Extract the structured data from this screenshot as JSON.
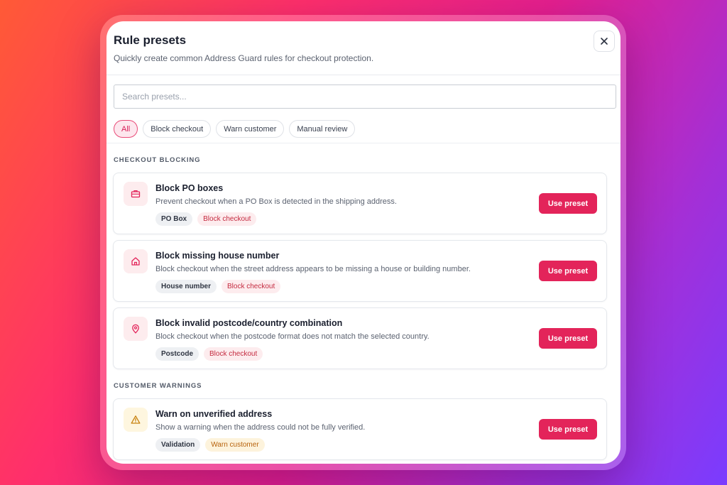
{
  "modal": {
    "title": "Rule presets",
    "subtitle": "Quickly create common Address Guard rules for checkout protection.",
    "close_icon": "close-icon"
  },
  "search": {
    "placeholder": "Search presets..."
  },
  "filters": [
    {
      "label": "All",
      "active": true
    },
    {
      "label": "Block checkout",
      "active": false
    },
    {
      "label": "Warn customer",
      "active": false
    },
    {
      "label": "Manual review",
      "active": false
    }
  ],
  "sections": {
    "blocking": {
      "label": "CHECKOUT BLOCKING",
      "presets": [
        {
          "icon": "briefcase-icon",
          "title": "Block PO boxes",
          "description": "Prevent checkout when a PO Box is detected in the shipping address.",
          "tags": [
            "PO Box",
            "Block checkout"
          ],
          "button": "Use preset"
        },
        {
          "icon": "home-icon",
          "title": "Block missing house number",
          "description": "Block checkout when the street address appears to be missing a house or building number.",
          "tags": [
            "House number",
            "Block checkout"
          ],
          "button": "Use preset"
        },
        {
          "icon": "map-pin-icon",
          "title": "Block invalid postcode/country combination",
          "description": "Block checkout when the postcode format does not match the selected country.",
          "tags": [
            "Postcode",
            "Block checkout"
          ],
          "button": "Use preset"
        }
      ]
    },
    "warnings": {
      "label": "CUSTOMER WARNINGS",
      "presets": [
        {
          "icon": "warning-icon",
          "title": "Warn on unverified address",
          "description": "Show a warning when the address could not be fully verified.",
          "tags": [
            "Validation",
            "Warn customer"
          ],
          "button": "Use preset"
        }
      ]
    }
  },
  "colors": {
    "accent": "#e3245a",
    "block_tag": "#c42a3f",
    "warn_tag": "#b7620c"
  }
}
